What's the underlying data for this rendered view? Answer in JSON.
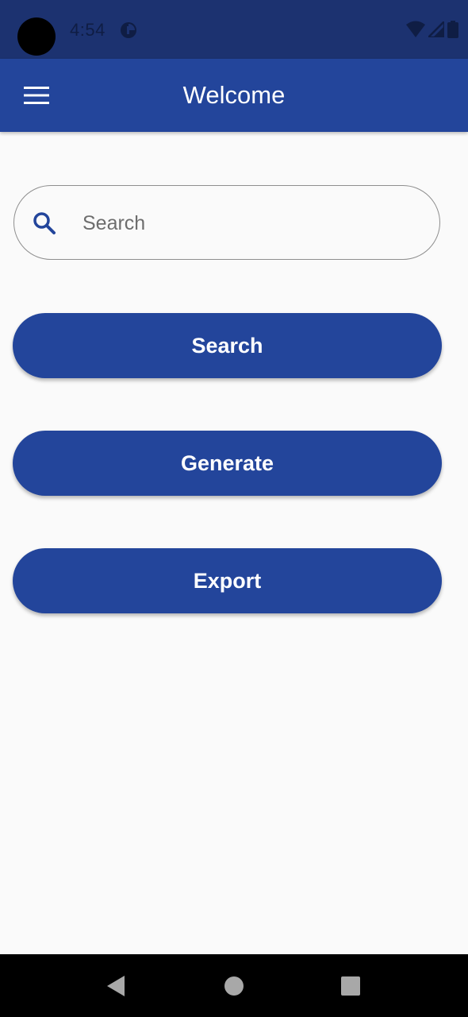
{
  "status_bar": {
    "time": "4:54",
    "icons": [
      "camera-hole",
      "app-notification-icon",
      "wifi-icon",
      "signal-icon",
      "battery-icon"
    ]
  },
  "app_bar": {
    "title": "Welcome",
    "menu_icon": "hamburger-menu-icon"
  },
  "search": {
    "placeholder": "Search",
    "value": "",
    "icon": "search-icon"
  },
  "buttons": [
    {
      "label": "Search"
    },
    {
      "label": "Generate"
    },
    {
      "label": "Export"
    }
  ],
  "nav_bar": {
    "icons": [
      "back-icon",
      "home-icon",
      "recents-icon"
    ]
  },
  "colors": {
    "primary": "#23459b",
    "status_bar": "#1c3270",
    "background": "#fafafa"
  }
}
